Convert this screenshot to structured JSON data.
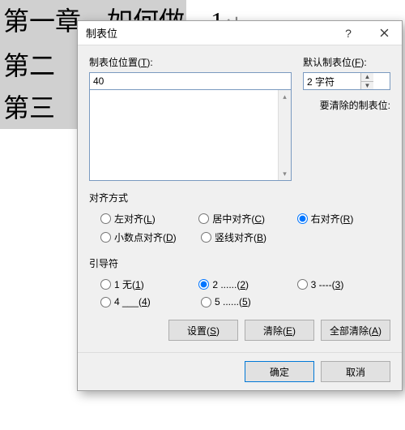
{
  "doc": {
    "line1": "第一章、如何做",
    "line1_tab": "→",
    "line1_num": "1",
    "line1_para": "↵",
    "line2": "第二",
    "line3": "第三"
  },
  "dialog": {
    "title": "制表位",
    "pos_label_pre": "制表位位置(",
    "pos_label_key": "T",
    "pos_label_post": "):",
    "pos_value": "40",
    "def_label_pre": "默认制表位(",
    "def_label_key": "F",
    "def_label_post": "):",
    "def_value": "2 字符",
    "clear_label": "要清除的制表位:",
    "align_title": "对齐方式",
    "align": {
      "left": "左对齐(",
      "left_k": "L",
      "left_post": ")",
      "center": "居中对齐(",
      "center_k": "C",
      "center_post": ")",
      "right": "右对齐(",
      "right_k": "R",
      "right_post": ")",
      "decimal": "小数点对齐(",
      "decimal_k": "D",
      "decimal_post": ")",
      "bar": "竖线对齐(",
      "bar_k": "B",
      "bar_post": ")"
    },
    "leader_title": "引导符",
    "leader": {
      "l1": "1 无(",
      "l1_k": "1",
      "l1_post": ")",
      "l2": "2 ......(",
      "l2_k": "2",
      "l2_post": ")",
      "l3": "3 ----(",
      "l3_k": "3",
      "l3_post": ")",
      "l4": "4 ___(",
      "l4_k": "4",
      "l4_post": ")",
      "l5": "5 ......(",
      "l5_k": "5",
      "l5_post": ")"
    },
    "btn_set": "设置(",
    "btn_set_k": "S",
    "btn_set_post": ")",
    "btn_clear": "清除(",
    "btn_clear_k": "E",
    "btn_clear_post": ")",
    "btn_clear_all": "全部清除(",
    "btn_clear_all_k": "A",
    "btn_clear_all_post": ")",
    "btn_ok": "确定",
    "btn_cancel": "取消"
  },
  "selected": {
    "align": "right",
    "leader": "2"
  }
}
